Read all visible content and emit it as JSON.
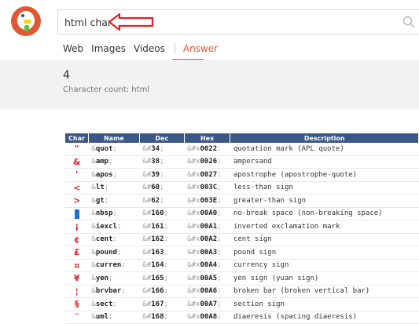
{
  "search": {
    "query": "html chars"
  },
  "tabs": [
    {
      "label": "Web"
    },
    {
      "label": "Images"
    },
    {
      "label": "Videos"
    },
    {
      "label": "Answer"
    }
  ],
  "answer": {
    "value": "4",
    "label": "Character count: html"
  },
  "table": {
    "headers": [
      "Char",
      "Name",
      "Dec",
      "Hex",
      "Description"
    ],
    "rows": [
      {
        "char": "\"",
        "name_pre": "&",
        "name_bold": "quot",
        "name_post": ";",
        "dec_pre": "&#",
        "dec_bold": "34",
        "dec_post": ";",
        "hex_pre": "&#x",
        "hex_bold": "0022",
        "hex_post": ";",
        "desc": "quotation mark (APL quote)"
      },
      {
        "char": "&",
        "name_pre": "&",
        "name_bold": "amp",
        "name_post": ";",
        "dec_pre": "&#",
        "dec_bold": "38",
        "dec_post": ";",
        "hex_pre": "&#x",
        "hex_bold": "0026",
        "hex_post": ";",
        "desc": "ampersand"
      },
      {
        "char": "'",
        "name_pre": "&",
        "name_bold": "apos",
        "name_post": ";",
        "dec_pre": "&#",
        "dec_bold": "39",
        "dec_post": ";",
        "hex_pre": "&#x",
        "hex_bold": "0027",
        "hex_post": ";",
        "desc": "apostrophe (apostrophe-quote)"
      },
      {
        "char": "<",
        "name_pre": "&",
        "name_bold": "lt",
        "name_post": ";",
        "dec_pre": "&#",
        "dec_bold": "60",
        "dec_post": ";",
        "hex_pre": "&#x",
        "hex_bold": "003C",
        "hex_post": ";",
        "desc": "less-than sign"
      },
      {
        "char": ">",
        "name_pre": "&",
        "name_bold": "gt",
        "name_post": ";",
        "dec_pre": "&#",
        "dec_bold": "62",
        "dec_post": ";",
        "hex_pre": "&#x",
        "hex_bold": "003E",
        "hex_post": ";",
        "desc": "greater-than sign"
      },
      {
        "char": "",
        "name_pre": "&",
        "name_bold": "nbsp",
        "name_post": ";",
        "dec_pre": "&#",
        "dec_bold": "160",
        "dec_post": ";",
        "hex_pre": "&#x",
        "hex_bold": "00A0",
        "hex_post": ";",
        "desc": "no-break space (non-breaking space)"
      },
      {
        "char": "¡",
        "name_pre": "&",
        "name_bold": "iexcl",
        "name_post": ";",
        "dec_pre": "&#",
        "dec_bold": "161",
        "dec_post": ";",
        "hex_pre": "&#x",
        "hex_bold": "00A1",
        "hex_post": ";",
        "desc": "inverted exclamation mark"
      },
      {
        "char": "¢",
        "name_pre": "&",
        "name_bold": "cent",
        "name_post": ";",
        "dec_pre": "&#",
        "dec_bold": "162",
        "dec_post": ";",
        "hex_pre": "&#x",
        "hex_bold": "00A2",
        "hex_post": ";",
        "desc": "cent sign"
      },
      {
        "char": "£",
        "name_pre": "&",
        "name_bold": "pound",
        "name_post": ";",
        "dec_pre": "&#",
        "dec_bold": "163",
        "dec_post": ";",
        "hex_pre": "&#x",
        "hex_bold": "00A3",
        "hex_post": ";",
        "desc": "pound sign"
      },
      {
        "char": "¤",
        "name_pre": "&",
        "name_bold": "curren",
        "name_post": ";",
        "dec_pre": "&#",
        "dec_bold": "164",
        "dec_post": ";",
        "hex_pre": "&#x",
        "hex_bold": "00A4",
        "hex_post": ";",
        "desc": "currency sign"
      },
      {
        "char": "¥",
        "name_pre": "&",
        "name_bold": "yen",
        "name_post": ";",
        "dec_pre": "&#",
        "dec_bold": "165",
        "dec_post": ";",
        "hex_pre": "&#x",
        "hex_bold": "00A5",
        "hex_post": ";",
        "desc": "yen sign (yuan sign)"
      },
      {
        "char": "¦",
        "name_pre": "&",
        "name_bold": "brvbar",
        "name_post": ";",
        "dec_pre": "&#",
        "dec_bold": "166",
        "dec_post": ";",
        "hex_pre": "&#x",
        "hex_bold": "00A6",
        "hex_post": ";",
        "desc": "broken bar (broken vertical bar)"
      },
      {
        "char": "§",
        "name_pre": "&",
        "name_bold": "sect",
        "name_post": ";",
        "dec_pre": "&#",
        "dec_bold": "167",
        "dec_post": ";",
        "hex_pre": "&#x",
        "hex_bold": "00A7",
        "hex_post": ";",
        "desc": "section sign"
      },
      {
        "char": "¨",
        "name_pre": "&",
        "name_bold": "uml",
        "name_post": ";",
        "dec_pre": "&#",
        "dec_bold": "168",
        "dec_post": ";",
        "hex_pre": "&#x",
        "hex_bold": "00A8",
        "hex_post": ";",
        "desc": "diaeresis (spacing diaeresis)"
      }
    ]
  },
  "colors": {
    "accent": "#de5833",
    "table_header": "#3b5785",
    "char_red": "#e0202a",
    "nbsp_block": "#1e6fd6"
  }
}
